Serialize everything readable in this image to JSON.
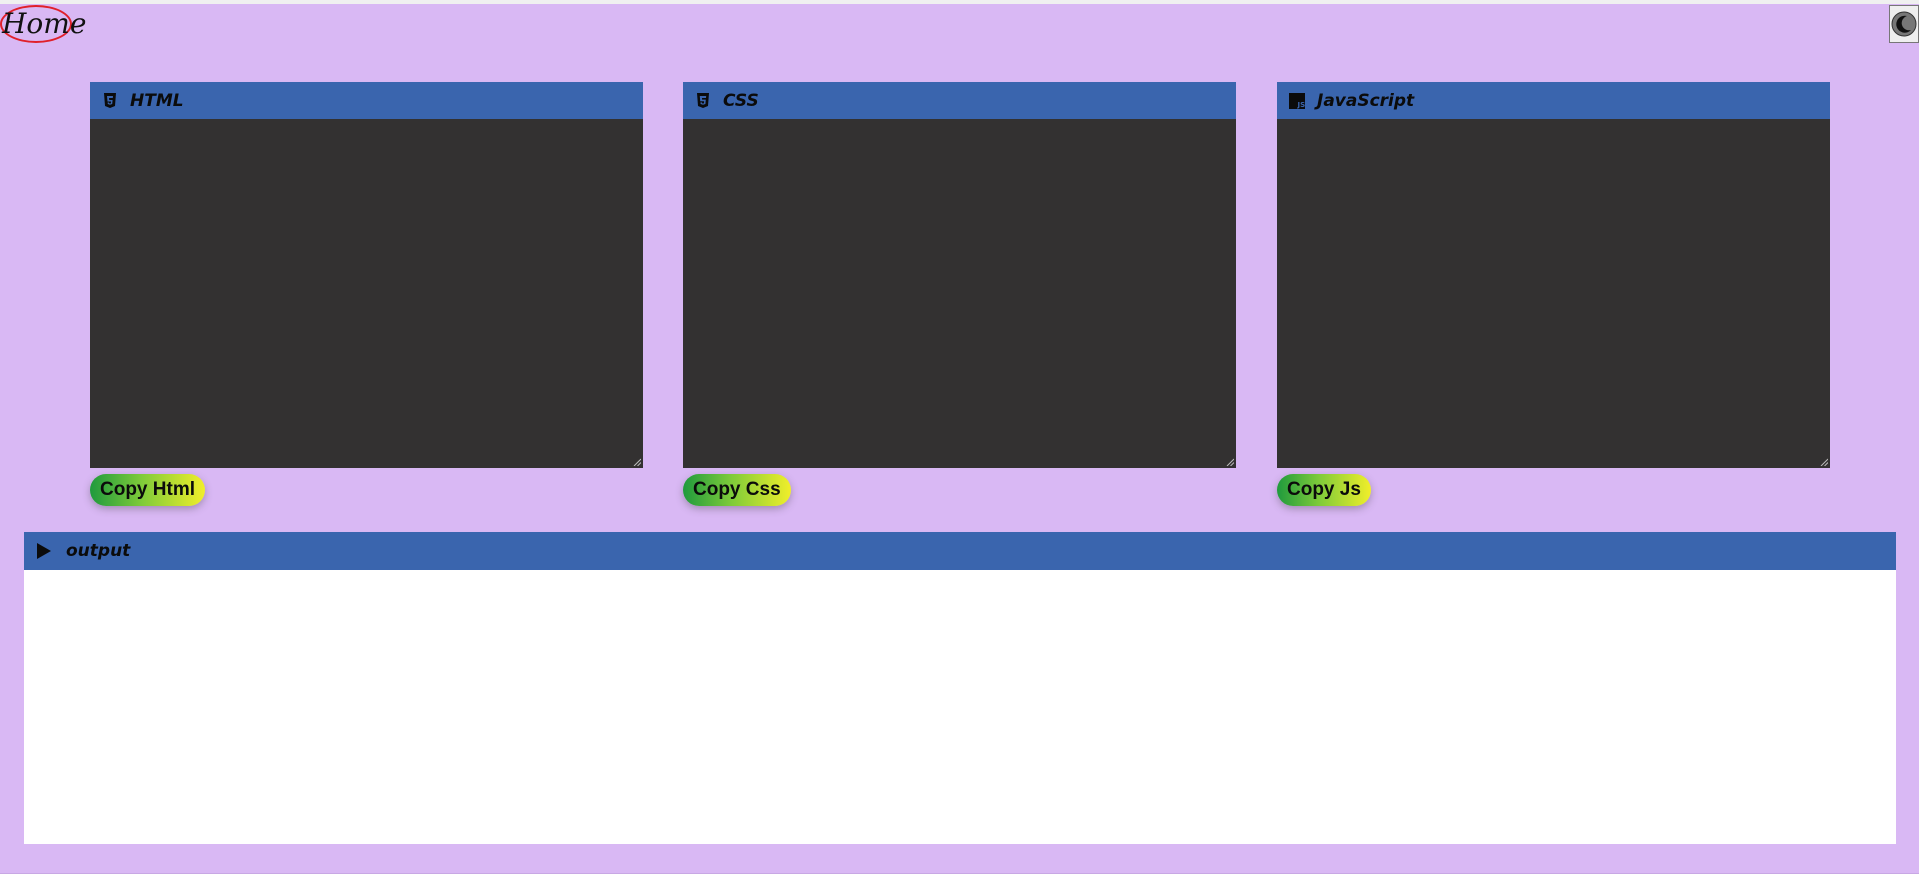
{
  "nav": {
    "home_label": "Home",
    "theme_toggle_icon": "moon-icon"
  },
  "editors": [
    {
      "title": "HTML",
      "icon": "html5-icon",
      "copy_label": "Copy Html",
      "value": ""
    },
    {
      "title": "CSS",
      "icon": "css3-icon",
      "copy_label": "Copy Css",
      "value": ""
    },
    {
      "title": "JavaScript",
      "icon": "js-icon",
      "copy_label": "Copy Js",
      "value": ""
    }
  ],
  "output": {
    "title": "output",
    "icon": "play-icon"
  },
  "colors": {
    "page_background": "#d9b8f4",
    "header_blue": "#3a65ae",
    "editor_background": "#333131",
    "home_outline": "#e0202a",
    "button_gradient": [
      "#1f9a3d",
      "#f1ee2a"
    ]
  }
}
